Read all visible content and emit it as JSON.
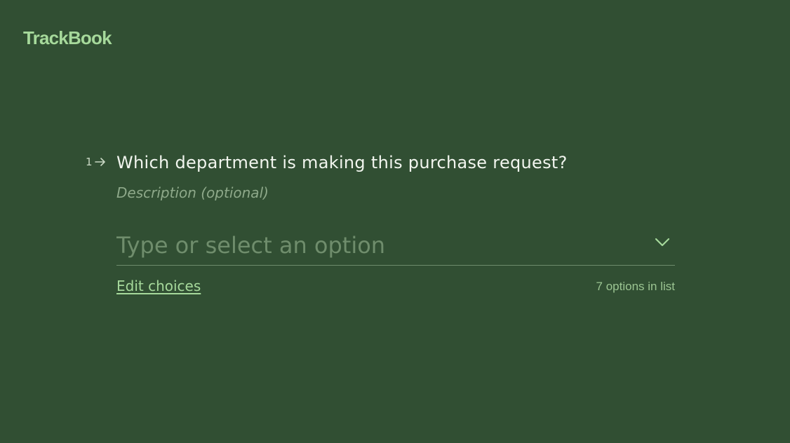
{
  "app": {
    "name": "TrackBook"
  },
  "question": {
    "number": "1",
    "arrow_icon": "arrow-right-icon",
    "title": "Which department is making this purchase request?",
    "description_placeholder": "Description (optional)"
  },
  "dropdown": {
    "placeholder": "Type or select an option",
    "value": "",
    "icon": "chevron-down-icon"
  },
  "choices": {
    "edit_label": "Edit choices",
    "count_text": "7 options in list"
  },
  "colors": {
    "background": "#314f33",
    "accent": "#a6d99b",
    "muted_text": "#6f8d6c"
  }
}
